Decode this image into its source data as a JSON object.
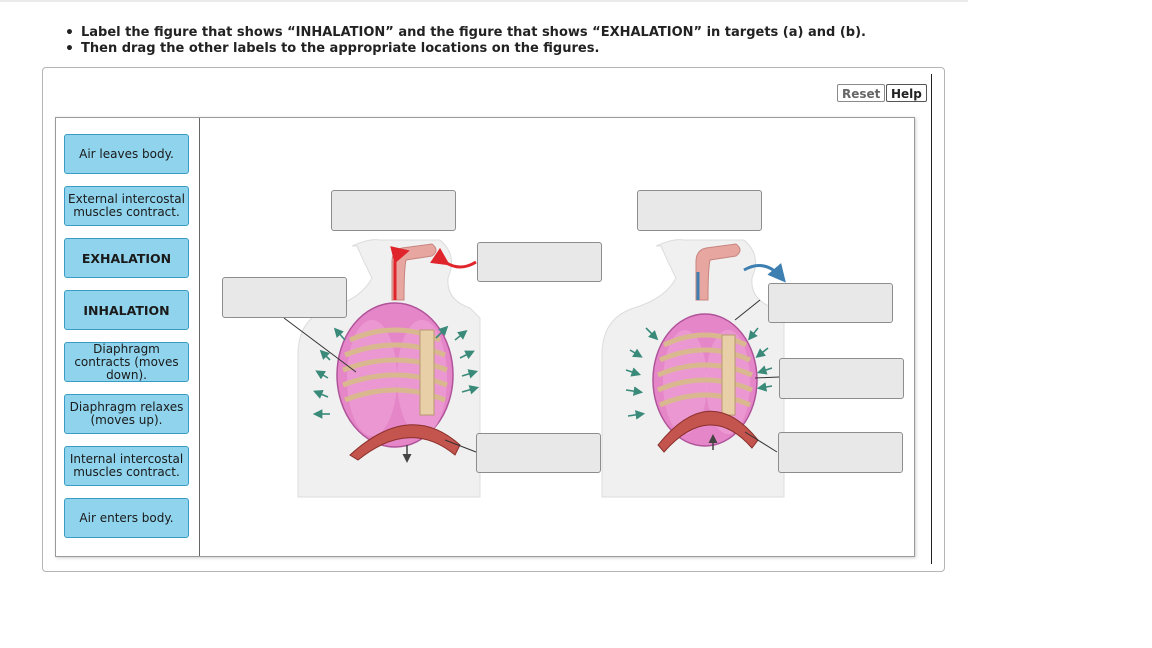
{
  "instructions": [
    "Label the figure that shows  “INHALATION”  and the figure that shows  “EXHALATION”  in targets (a) and (b).",
    "Then drag the other labels to the appropriate locations on the figures."
  ],
  "toolbar": {
    "reset_label": "Reset",
    "help_label": "Help"
  },
  "label_bank": [
    "Air leaves body.",
    "External intercostal muscles contract.",
    "EXHALATION",
    "INHALATION",
    "Diaphragm contracts (moves down).",
    "Diaphragm relaxes (moves up).",
    "Internal intercostal muscles contract.",
    "Air enters body."
  ],
  "colors": {
    "label_fill": "#8fd3ec",
    "label_border": "#3a9cc5",
    "target_fill": "#e8e8e8",
    "lung_pink": "#e586c8",
    "arrow_red": "#e0242b",
    "arrow_blue": "#3d7fb0",
    "muscle_arrow_teal": "#3a8a7a"
  }
}
